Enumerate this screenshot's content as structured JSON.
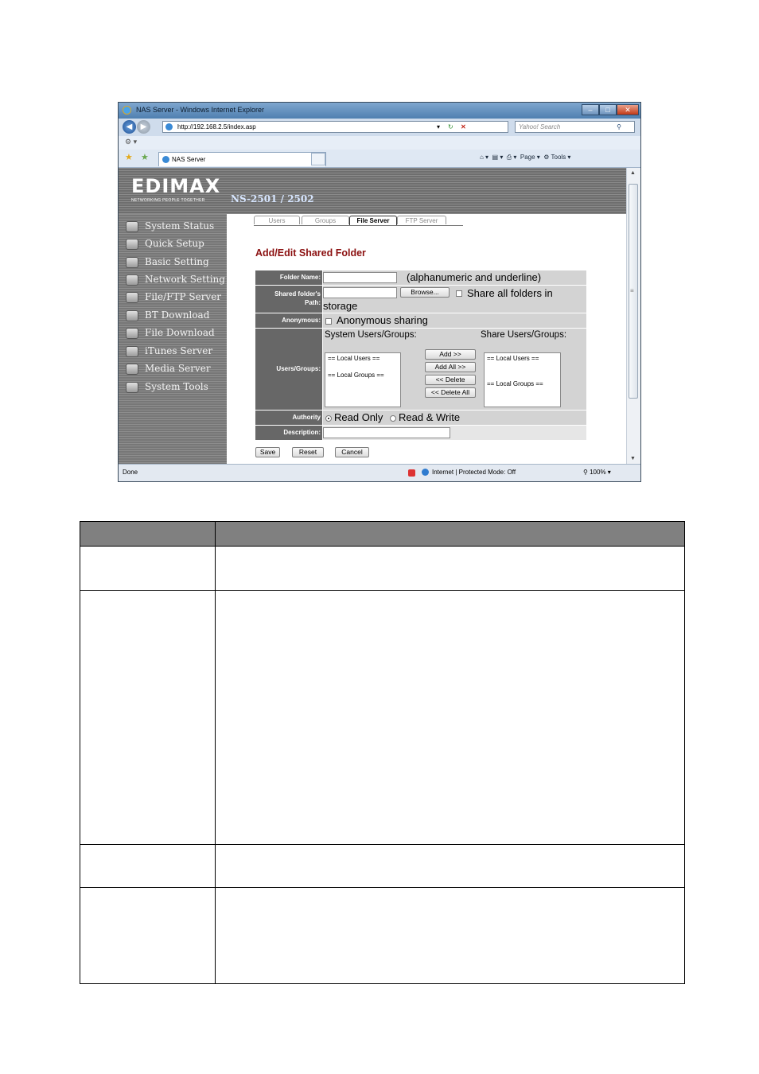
{
  "browser": {
    "title": "NAS Server - Windows Internet Explorer",
    "url": "http://192.168.2.5/index.asp",
    "search_placeholder": "Yahoo! Search",
    "tab_title": "NAS Server",
    "toolbar": {
      "page": "Page",
      "tools": "Tools"
    },
    "status_left": "Done",
    "status_zone": "Internet | Protected Mode: Off",
    "zoom": "100%"
  },
  "app": {
    "brand": "EDIMAX",
    "tagline": "NETWORKING PEOPLE TOGETHER",
    "model": "NS-2501 / 2502",
    "menu": [
      "System Status",
      "Quick Setup",
      "Basic Setting",
      "Network Setting",
      "File/FTP Server",
      "BT Download",
      "File Download",
      "iTunes Server",
      "Media Server",
      "System Tools"
    ],
    "tabs": [
      "Users",
      "Groups",
      "File Server",
      "FTP Server"
    ],
    "active_tab": "File Server"
  },
  "form": {
    "heading": "Add/Edit Shared Folder",
    "folder_name_label": "Folder Name:",
    "folder_name_hint": "(alphanumeric and underline)",
    "path_label_1": "Shared folder's",
    "path_label_2": "Path:",
    "browse_button": "Browse...",
    "share_all_label": "Share all folders in",
    "share_all_label_2": "storage",
    "anonymous_label": "Anonymous:",
    "anonymous_option": "Anonymous sharing",
    "users_groups_label": "Users/Groups:",
    "system_users_title": "System Users/Groups:",
    "share_users_title": "Share Users/Groups:",
    "system_list": [
      "== Local Users ==",
      "== Local Groups =="
    ],
    "share_list": [
      "== Local Users ==",
      "== Local Groups =="
    ],
    "add_button": "Add >>",
    "add_all_button": "Add All >>",
    "delete_button": "<< Delete",
    "delete_all_button": "<< Delete All",
    "authority_label": "Authority",
    "read_only": "Read Only",
    "read_write": "Read & Write",
    "description_label": "Description:",
    "save_button": "Save",
    "reset_button": "Reset",
    "cancel_button": "Cancel"
  },
  "colors": {
    "heading": "#8b1010",
    "label_cell": "#676767",
    "value_cell": "#d3d3d3",
    "table_header": "#808080"
  }
}
